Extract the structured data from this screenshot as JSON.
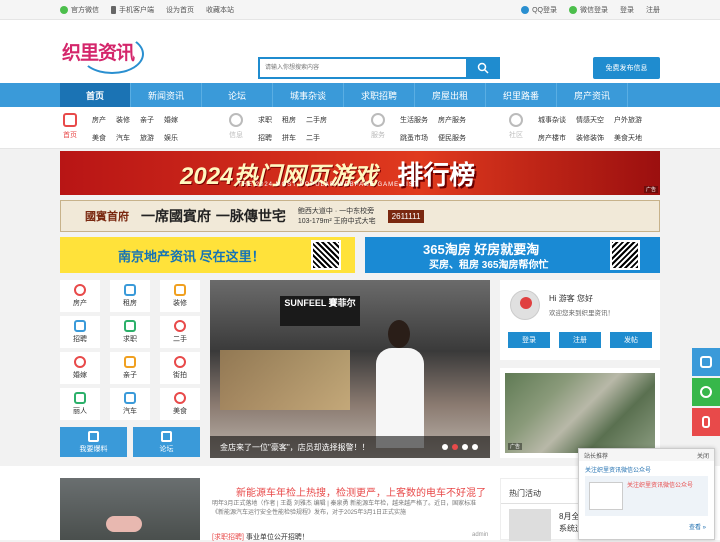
{
  "topbar": {
    "left": [
      "官方微信",
      "手机客户端",
      "设为首页",
      "收藏本站"
    ],
    "right": [
      "QQ登录",
      "微信登录",
      "登录",
      "注册"
    ]
  },
  "logo": {
    "text": "织里资讯"
  },
  "search": {
    "placeholder": "请输入你想搜索内容"
  },
  "header": {
    "post_label": "免费发布信息"
  },
  "nav": [
    "首页",
    "新闻资讯",
    "论坛",
    "城事杂谈",
    "求职招聘",
    "房屋出租",
    "织里路番",
    "房产资讯"
  ],
  "subnav": {
    "home": {
      "label": "首页",
      "links": [
        "房产",
        "美食",
        "装修",
        "汽车",
        "亲子",
        "旅游",
        "婚嫁",
        "娱乐"
      ]
    },
    "info": {
      "label": "信息",
      "links": [
        "求职",
        "招聘",
        "租房",
        "拼车",
        "二手房",
        "二手"
      ]
    },
    "service": {
      "label": "服务",
      "links": [
        "生活服务",
        "跳蚤市场",
        "房产服务",
        "便民服务"
      ]
    },
    "community": {
      "label": "社区",
      "links": [
        "城事杂谈",
        "房产楼市",
        "情感天空",
        "装修装饰",
        "户外旅游",
        "美食天地"
      ]
    }
  },
  "banners": {
    "game_title": "2024热门网页游戏",
    "game_sub": "THE 2024 MOST POPULAR WEBPAGE GAME LIST",
    "game_rank": "排行榜",
    "game_ad": "广告",
    "estate_name": "國賓首府",
    "estate_slogan": "一席國賓府 一脉傳世宅",
    "estate_loc": "鲍西大道中 · 一中东校旁",
    "estate_area": "103-179m² 王府中式大宅",
    "estate_phone": "2611111",
    "nanjing_text": "南京地产资讯 尽在这里！",
    "taofang_title": "365淘房 好房就要淘",
    "taofang_sub": "买房、租房 365淘房帮你忙"
  },
  "grid": [
    {
      "label": "房产",
      "icon": "house-icon"
    },
    {
      "label": "租房",
      "icon": "key-icon"
    },
    {
      "label": "装修",
      "icon": "paint-icon"
    },
    {
      "label": "招聘",
      "icon": "briefcase-icon"
    },
    {
      "label": "求职",
      "icon": "resume-icon"
    },
    {
      "label": "二手",
      "icon": "tag-icon"
    },
    {
      "label": "婚嫁",
      "icon": "ring-icon"
    },
    {
      "label": "亲子",
      "icon": "baby-icon"
    },
    {
      "label": "街拍",
      "icon": "camera-icon"
    },
    {
      "label": "丽人",
      "icon": "beauty-icon"
    },
    {
      "label": "汽车",
      "icon": "car-icon"
    },
    {
      "label": "美食",
      "icon": "food-icon"
    }
  ],
  "actions": {
    "report": "我要爆料",
    "forum": "论坛"
  },
  "slider": {
    "shop_sign": "SUNFEEL 賽菲尔",
    "caption": "金店来了一位\"豪客\"，店员却选择报警！！",
    "slides": 4,
    "active": 2
  },
  "user": {
    "greeting": "Hi 游客 您好",
    "welcome": "欢迎您来到织里资讯！",
    "buttons": [
      "登录",
      "注册",
      "发帖"
    ]
  },
  "map_ad": "广告",
  "article": {
    "headline": "新能源车年检上热搜，检测更严，上客数的电车不好混了",
    "excerpt": "明年3月正式落地（作者 | 王磊 刘雅杰 编辑 | 秦泉勇 新能源车年检，越来越严格了。近日，国家标准《新能源汽车运行安全性能检验规程》发布，对于2025年3月1日正式实施",
    "tag": "[求职招聘]",
    "tag_text": "事业单位公开招聘！",
    "author": "admin"
  },
  "hot": {
    "title": "热门活动",
    "item": "8月全\n系统运"
  },
  "popup": {
    "title": "站长推荐",
    "close": "关闭",
    "headline": "关注织里资讯微信公众号",
    "inner": "关注织里资讯微信公众号",
    "more": "查看 »"
  },
  "colors": {
    "accent": "#1f8ccf",
    "nav": "#3a9ad9",
    "red": "#e84a4a"
  }
}
